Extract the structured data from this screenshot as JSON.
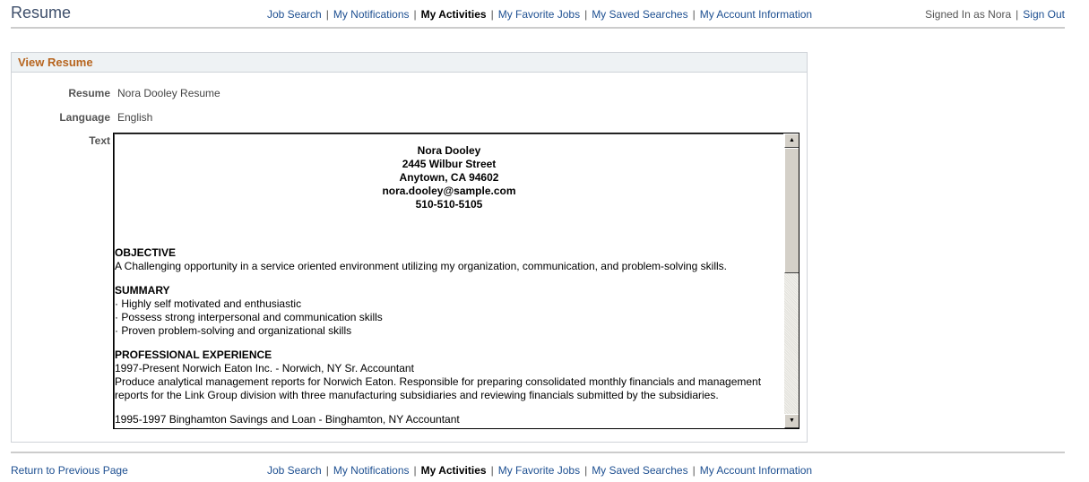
{
  "header": {
    "title": "Resume",
    "nav": [
      {
        "label": "Job Search",
        "current": false
      },
      {
        "label": "My Notifications",
        "current": false
      },
      {
        "label": "My Activities",
        "current": true
      },
      {
        "label": "My Favorite Jobs",
        "current": false
      },
      {
        "label": "My Saved Searches",
        "current": false
      },
      {
        "label": "My Account Information",
        "current": false
      }
    ],
    "separator": "|",
    "signed_in_text": "Signed In as Nora",
    "sign_out_label": "Sign Out"
  },
  "group": {
    "title": "View Resume",
    "fields": {
      "resume_label": "Resume",
      "resume_value": "Nora Dooley Resume",
      "language_label": "Language",
      "language_value": "English",
      "text_label": "Text"
    },
    "resume_text": {
      "header_lines": [
        "Nora Dooley",
        "2445 Wilbur Street",
        "Anytown, CA  94602",
        "nora.dooley@sample.com",
        "510-510-5105"
      ],
      "sections": [
        {
          "title": "OBJECTIVE",
          "lines": [
            "A Challenging opportunity in a service oriented environment utilizing my organization, communication, and problem-solving skills."
          ]
        },
        {
          "title": "SUMMARY",
          "lines": [
            "· Highly self motivated and enthusiastic",
            "· Possess strong interpersonal and communication skills",
            "· Proven problem-solving and organizational skills"
          ]
        },
        {
          "title": "PROFESSIONAL EXPERIENCE",
          "lines": [
            "1997-Present   Norwich Eaton Inc. - Norwich, NY  Sr. Accountant",
            "Produce analytical management reports for Norwich Eaton. Responsible for preparing consolidated monthly financials and management",
            "reports for the Link Group division with three manufacturing subsidiaries and reviewing financials submitted by the subsidiaries."
          ]
        },
        {
          "title": "",
          "lines": [
            "1995-1997  Binghamton Savings and Loan - Binghamton, NY  Accountant"
          ]
        }
      ]
    },
    "scrollbar": {
      "up_arrow": "▲",
      "down_arrow": "▼"
    }
  },
  "footer": {
    "return_label": "Return to Previous Page"
  }
}
